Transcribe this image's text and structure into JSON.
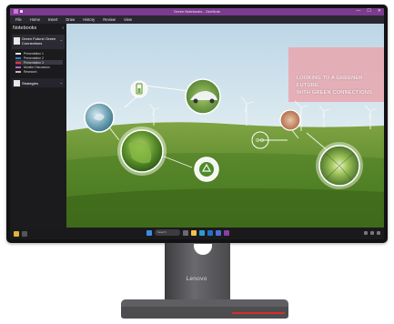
{
  "window": {
    "title": "Green Notebooks - OneNote",
    "controls": [
      "—",
      "☐",
      "✕"
    ]
  },
  "ribbon": [
    "File",
    "Home",
    "Insert",
    "Draw",
    "History",
    "Review",
    "View"
  ],
  "sidebar": {
    "header": "Notebooks",
    "notebook": {
      "name": "Green Future/ Green Connections",
      "sections": [
        {
          "label": "Presentation 1",
          "color": "#e8e8e8"
        },
        {
          "label": "Presentation 2",
          "color": "#2f7fd6"
        },
        {
          "label": "Presentation 3",
          "color": "#d83a3a"
        },
        {
          "label": "Monitor Discussion",
          "color": "#c45bd1"
        },
        {
          "label": "Research",
          "color": "#b8b8b8"
        }
      ]
    },
    "notebook2": {
      "name": "Strategies"
    }
  },
  "slide": {
    "headline_line1": "LOOKING TO A GREENER FUTURE",
    "headline_line2": "WITH GREEN CONNECTIONS",
    "colors": {
      "sky": "#cfe3ee",
      "grass": "#5c8f2f",
      "accent_panel": "#e9a6ae"
    }
  },
  "taskbar": {
    "search_placeholder": "Search",
    "icons": [
      "windows-icon",
      "search-icon",
      "task-view-icon",
      "file-explorer-icon",
      "browser-icon",
      "mail-icon",
      "store-icon",
      "onenote-icon"
    ],
    "tray_icons": [
      "wifi-icon",
      "volume-icon",
      "battery-icon"
    ]
  },
  "stand": {
    "brand": "Lenovo"
  }
}
